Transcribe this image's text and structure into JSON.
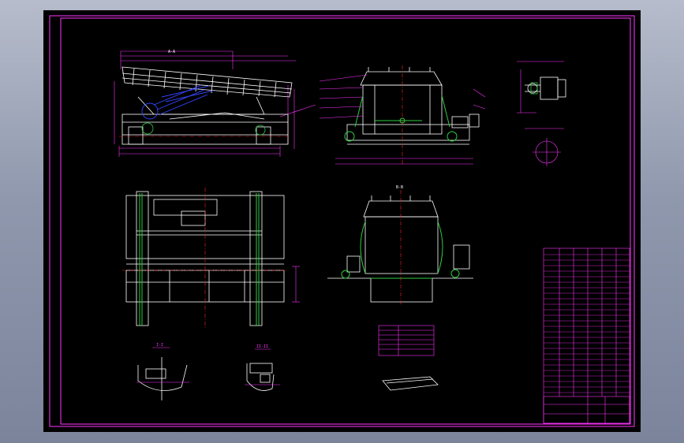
{
  "viewport": {
    "background": "#000000",
    "app_background": "#9aa2b6"
  },
  "colors": {
    "frame": "#ff33ff",
    "geometry": "#ffffff",
    "accent_green": "#2ecc40",
    "accent_blue": "#3344ff",
    "accent_red": "#ff2222",
    "dimension": "#ff33ff"
  },
  "drawing": {
    "section_labels": {
      "side_view_section": "A-A",
      "plan_section": "B-B",
      "detail_1": "I-I",
      "detail_2": "II-II"
    }
  },
  "title_block": {
    "present": true
  }
}
